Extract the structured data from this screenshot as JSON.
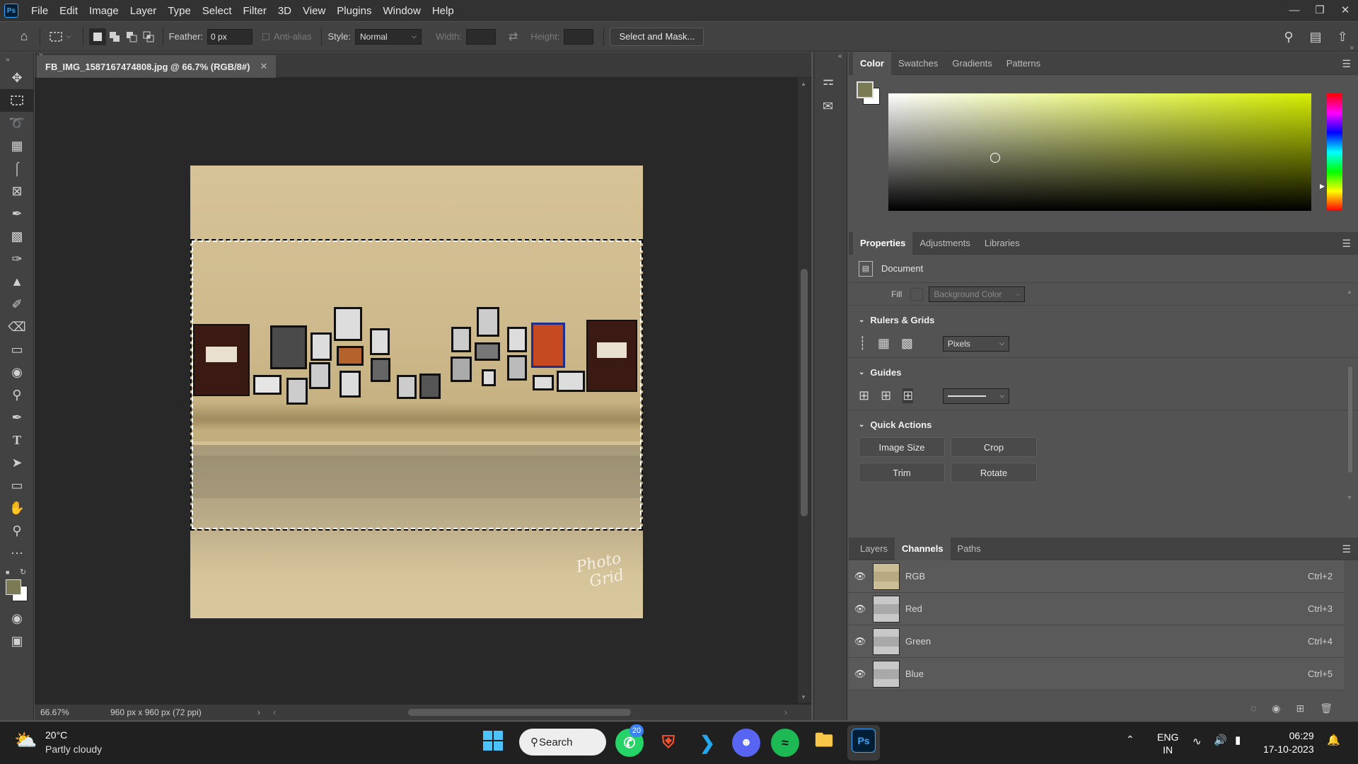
{
  "menubar": {
    "logo": "Ps",
    "items": [
      "File",
      "Edit",
      "Image",
      "Layer",
      "Type",
      "Select",
      "Filter",
      "3D",
      "View",
      "Plugins",
      "Window",
      "Help"
    ]
  },
  "options": {
    "feather_label": "Feather:",
    "feather_value": "0 px",
    "antialias_label": "Anti-alias",
    "style_label": "Style:",
    "style_value": "Normal",
    "width_label": "Width:",
    "height_label": "Height:",
    "select_mask_label": "Select and Mask..."
  },
  "document": {
    "tab_title": "FB_IMG_1587167474808.jpg @ 66.7% (RGB/8#)",
    "zoom": "66.67%",
    "dimensions": "960 px x 960 px (72 ppi)",
    "watermark_line1": "Photo",
    "watermark_line2": "Grid"
  },
  "color_panel": {
    "tabs": [
      "Color",
      "Swatches",
      "Gradients",
      "Patterns"
    ],
    "fg_color": "#7a7a55",
    "hue_color": "#d6ef00"
  },
  "properties_panel": {
    "tabs": [
      "Properties",
      "Adjustments",
      "Libraries"
    ],
    "doc_label": "Document",
    "fill_label": "Fill",
    "fill_value": "Background Color",
    "rulers_title": "Rulers & Grids",
    "units_value": "Pixels",
    "guides_title": "Guides",
    "quick_actions_title": "Quick Actions",
    "actions": [
      "Image Size",
      "Crop",
      "Trim",
      "Rotate"
    ]
  },
  "channels_panel": {
    "tabs": [
      "Layers",
      "Channels",
      "Paths"
    ],
    "rows": [
      {
        "name": "RGB",
        "shortcut": "Ctrl+2"
      },
      {
        "name": "Red",
        "shortcut": "Ctrl+3"
      },
      {
        "name": "Green",
        "shortcut": "Ctrl+4"
      },
      {
        "name": "Blue",
        "shortcut": "Ctrl+5"
      }
    ]
  },
  "taskbar": {
    "weather_temp": "20°C",
    "weather_desc": "Partly cloudy",
    "search_label": "Search",
    "whatsapp_badge": "20",
    "lang_line1": "ENG",
    "lang_line2": "IN",
    "time": "06:29",
    "date": "17-10-2023"
  }
}
